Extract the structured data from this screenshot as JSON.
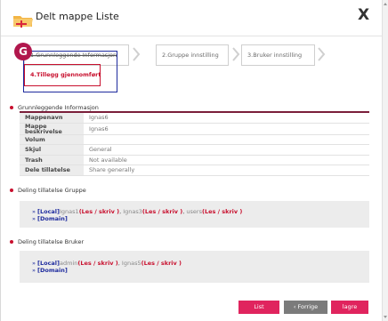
{
  "header": {
    "title": "Delt mappe Liste",
    "close_label": "X"
  },
  "steps": [
    {
      "label": "1.Grunnleggende Informasjon"
    },
    {
      "label": "2.Gruppe innstilling"
    },
    {
      "label": "3.Bruker innstilling"
    },
    {
      "label": "4.Tillegg gjennomført"
    }
  ],
  "badge": "G",
  "basic_info": {
    "title": "Grunnleggende Informasjon",
    "rows": [
      {
        "key": "Mappenavn",
        "value": "Ignas6"
      },
      {
        "key": "Mappe beskrivelse",
        "value": "Ignas6"
      },
      {
        "key": "Volum",
        "value": ""
      },
      {
        "key": "Skjul",
        "value": "General"
      },
      {
        "key": "Trash",
        "value": "Not available"
      },
      {
        "key": "Dele tillatelse",
        "value": "Share generally"
      }
    ]
  },
  "group_perm": {
    "title": "Deling tillatelse Gruppe",
    "local_tag": "[Local]",
    "domain_tag": "[Domain]",
    "entries": [
      {
        "name": "Ignas1",
        "rights": "(Les / skriv )"
      },
      {
        "name": "Ignas3",
        "rights": "(Les / skriv )"
      },
      {
        "name": "users",
        "rights": "(Les / skriv )"
      }
    ]
  },
  "user_perm": {
    "title": "Deling tillatelse Bruker",
    "local_tag": "[Local]",
    "domain_tag": "[Domain]",
    "entries": [
      {
        "name": "admin",
        "rights": "(Les / skriv )"
      },
      {
        "name": "Ignas5",
        "rights": "(Les / skriv )"
      }
    ]
  },
  "buttons": {
    "list": "List",
    "prev": "‹ Forrige",
    "save": "lagre"
  },
  "colors": {
    "accent": "#e0245e",
    "badge": "#b1174d",
    "highlight": "#1e2b9e",
    "table_border": "#7a1e3a"
  }
}
